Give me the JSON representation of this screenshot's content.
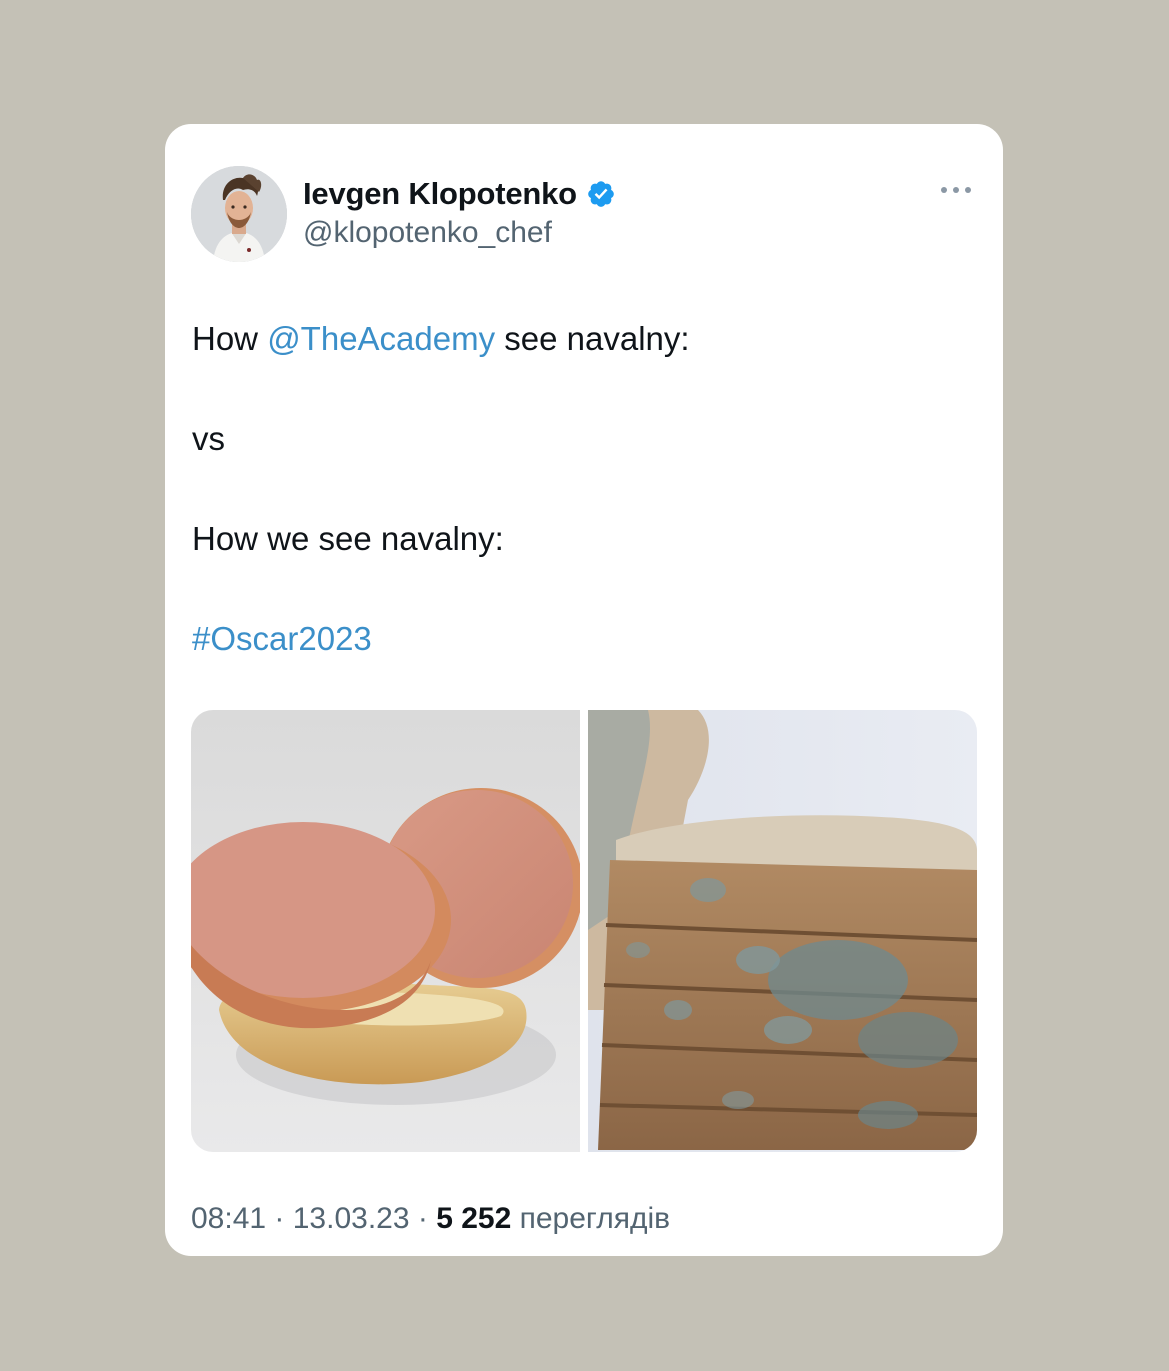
{
  "tweet": {
    "author": {
      "display_name": "Ievgen Klopotenko",
      "handle": "@klopotenko_chef",
      "verified": true,
      "verified_icon": "verified-badge-icon",
      "avatar_icon": "profile-photo"
    },
    "more_icon": "ellipsis-icon",
    "text": {
      "line1_prefix": "How ",
      "line1_mention": "@TheAcademy",
      "line1_suffix": " see navalny:",
      "line2": "vs",
      "line3": "How we see navalny:",
      "hashtag": "#Oscar2023"
    },
    "media": [
      {
        "icon": "sausage-sandwich-photo"
      },
      {
        "icon": "moldy-bread-photo"
      }
    ],
    "meta": {
      "time": "08:41",
      "separator1": " · ",
      "date": "13.03.23",
      "separator2": " · ",
      "views_count": "5 252",
      "views_label": " переглядів"
    }
  },
  "colors": {
    "background": "#c4c1b6",
    "card": "#ffffff",
    "link": "#3b8fc9",
    "secondary_text": "#536471",
    "verified": "#1d9bf0"
  }
}
